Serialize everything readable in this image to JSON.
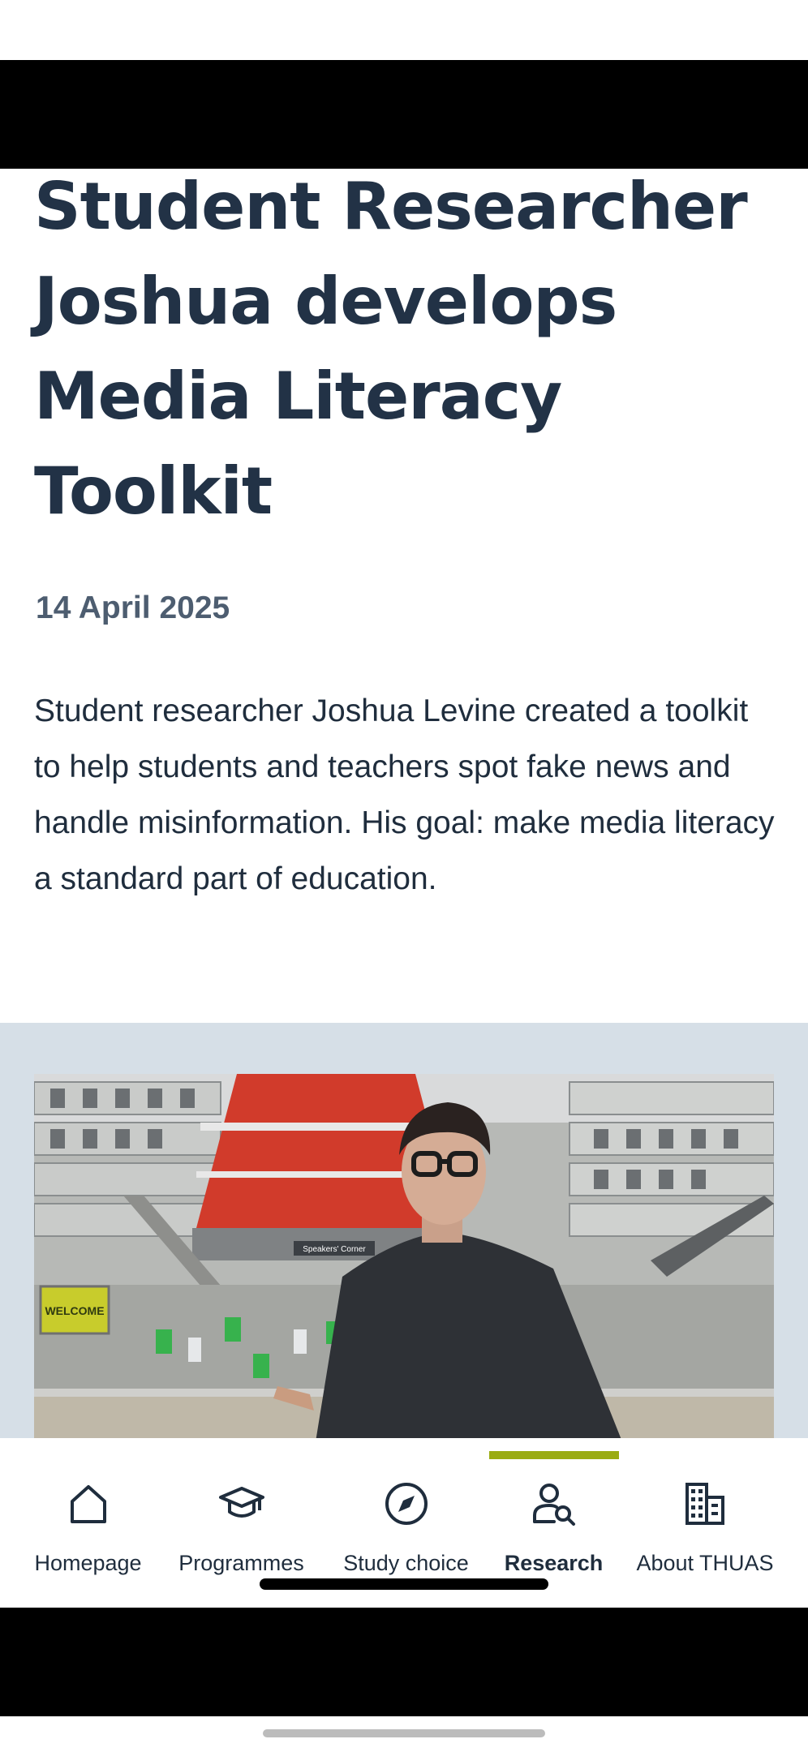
{
  "article": {
    "title": "Student Researcher Joshua develops Media Literacy Toolkit",
    "date": "14 April 2025",
    "intro": "Student researcher Joshua Levine created a toolkit to help students and teachers spot fake news and handle misinformation. His goal: make media literacy a standard part of education.",
    "photo_sign_text": "Speakers' Corner",
    "photo_banner_text": "WELCOME"
  },
  "tabbar": {
    "active": "research",
    "items": [
      {
        "key": "homepage",
        "label": "Homepage",
        "icon": "home-icon"
      },
      {
        "key": "programmes",
        "label": "Programmes",
        "icon": "graduation-cap-icon"
      },
      {
        "key": "study_choice",
        "label": "Study choice",
        "icon": "compass-icon"
      },
      {
        "key": "research",
        "label": "Research",
        "icon": "person-search-icon"
      },
      {
        "key": "about",
        "label": "About THUAS",
        "icon": "building-icon"
      }
    ]
  },
  "colors": {
    "heading": "#223246",
    "date": "#4d5d70",
    "image_band": "#d6dfe7",
    "active_accent": "#9aac12"
  }
}
